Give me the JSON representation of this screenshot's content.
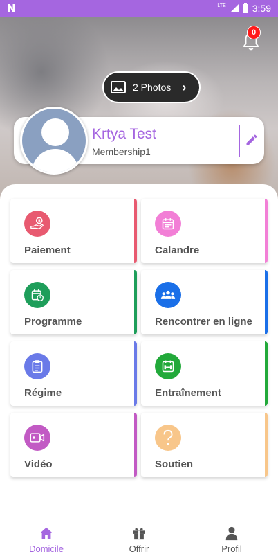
{
  "status_bar": {
    "network_label": "LTE",
    "time": "3:59"
  },
  "header": {
    "notification_count": "0",
    "photos_button_label": "2 Photos"
  },
  "profile": {
    "name": "Krtya Test",
    "membership": "Membership1"
  },
  "tiles": [
    {
      "label": "Paiement",
      "icon": "payment-icon",
      "color": "#e85a70",
      "accent": "#e85a70"
    },
    {
      "label": "Calandre",
      "icon": "calendar-icon",
      "color": "#f27fd6",
      "accent": "#f27fd6"
    },
    {
      "label": "Programme",
      "icon": "schedule-icon",
      "color": "#1e9e5a",
      "accent": "#1e9e5a"
    },
    {
      "label": "Rencontrer en ligne",
      "icon": "group-meeting-icon",
      "color": "#1a6fe8",
      "accent": "#1a6fe8"
    },
    {
      "label": "Régime",
      "icon": "clipboard-icon",
      "color": "#6a7ae8",
      "accent": "#6a7ae8"
    },
    {
      "label": "Entraînement",
      "icon": "dumbbell-icon",
      "color": "#22a93a",
      "accent": "#22a93a"
    },
    {
      "label": "Vidéo",
      "icon": "video-icon",
      "color": "#c25ac4",
      "accent": "#c25ac4"
    },
    {
      "label": "Soutien",
      "icon": "question-icon",
      "color": "#f8c68a",
      "accent": "#f8c68a"
    }
  ],
  "bottom_nav": {
    "items": [
      {
        "label": "Domicile",
        "icon": "home-icon",
        "active": true
      },
      {
        "label": "Offrir",
        "icon": "gift-icon",
        "active": false
      },
      {
        "label": "Profil",
        "icon": "person-icon",
        "active": false
      }
    ]
  },
  "colors": {
    "accent": "#a566e0",
    "badge": "#ff1a1a"
  }
}
